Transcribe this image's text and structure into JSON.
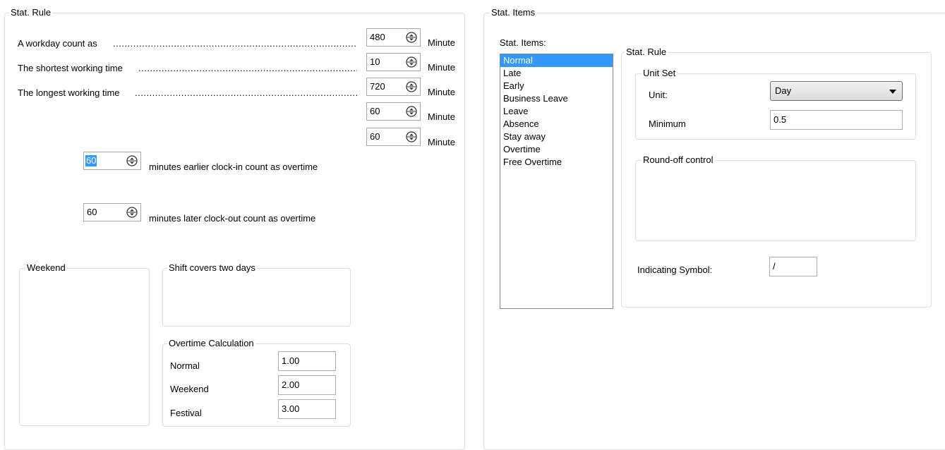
{
  "left_panel": {
    "title": "Stat. Rule",
    "rows": [
      {
        "label": "A workday count as",
        "value": "480",
        "unit": "Minute"
      },
      {
        "label": "The shortest working time",
        "value": "10",
        "unit": "Minute"
      },
      {
        "label": "The longest working time",
        "value": "720",
        "unit": "Minute"
      },
      {
        "label": "",
        "value": "60",
        "unit": "Minute"
      },
      {
        "label": "",
        "value": "60",
        "unit": "Minute"
      }
    ],
    "earlier_value": "60",
    "earlier_label": "minutes earlier clock-in count as overtime",
    "later_value": "60",
    "later_label": "minutes later clock-out count as overtime",
    "weekend_title": "Weekend",
    "shift_title": "Shift covers two days",
    "overtime": {
      "title": "Overtime Calculation",
      "rows": [
        {
          "label": "Normal",
          "value": "1.00"
        },
        {
          "label": "Weekend",
          "value": "2.00"
        },
        {
          "label": "Festival",
          "value": "3.00"
        }
      ]
    }
  },
  "right_panel": {
    "title": "Stat. Items",
    "items_label": "Stat. Items:",
    "items": [
      "Normal",
      "Late",
      "Early",
      "Business Leave",
      "Leave",
      "Absence",
      "Stay away",
      "Overtime",
      "Free Overtime"
    ],
    "selected_index": 0,
    "rule": {
      "title": "Stat. Rule",
      "unit_set_title": "Unit Set",
      "unit_label": "Unit:",
      "unit_value": "Day",
      "minimum_label": "Minimum",
      "minimum_value": "0.5",
      "roundoff_title": "Round-off control",
      "symbol_label": "Indicating Symbol:",
      "symbol_value": "/"
    }
  },
  "icons": {
    "spin": "spin-up-down-icon",
    "dropdown": "chevron-down-icon"
  },
  "colors": {
    "selection": "#3399ff",
    "group_border": "#d5dfe5"
  }
}
